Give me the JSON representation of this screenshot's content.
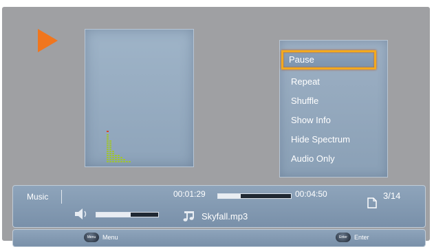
{
  "menu": {
    "items": [
      {
        "label": "Pause",
        "selected": true
      },
      {
        "label": "Repeat",
        "selected": false
      },
      {
        "label": "Shuffle",
        "selected": false
      },
      {
        "label": "Show Info",
        "selected": false
      },
      {
        "label": "Hide Spectrum",
        "selected": false
      },
      {
        "label": "Audio Only",
        "selected": false
      }
    ]
  },
  "info": {
    "source_label": "Music",
    "elapsed_time": "00:01:29",
    "total_time": "00:04:50",
    "playback_progress": 0.31,
    "track_position": "3/14",
    "filename": "Skyfall.mp3",
    "volume_level": 0.55
  },
  "nav": {
    "menu_key_badge": "Menu",
    "menu_label": "Menu",
    "enter_key_badge": "Enter",
    "enter_label": "Enter"
  },
  "spectrum": {
    "bar_levels": [
      14,
      11,
      6,
      4,
      4,
      3,
      2,
      1,
      1
    ],
    "peak_on_bar": 0
  },
  "icons": {
    "play": "play-icon",
    "speaker": "speaker-icon",
    "note": "music-note-icon",
    "file": "file-icon"
  },
  "colors": {
    "accent_orange": "#f0761e",
    "selection_border": "#f3a91f",
    "spectrum_green": "#9ec23a",
    "spectrum_peak_red": "#d9432b"
  }
}
